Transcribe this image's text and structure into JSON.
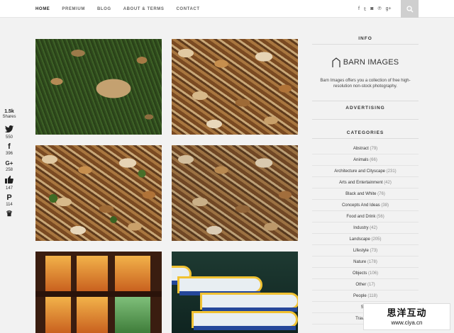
{
  "nav": {
    "items": [
      "HOME",
      "PREMIUM",
      "BLOG",
      "ABOUT & TERMS",
      "CONTACT"
    ],
    "social": [
      "f",
      "𝕥",
      "◙",
      "℗",
      "g+"
    ]
  },
  "share": {
    "total": "1.5k",
    "label": "Shares",
    "items": [
      {
        "icon": "twitter-icon",
        "glyph": "🐦",
        "count": "550"
      },
      {
        "icon": "facebook-icon",
        "glyph": "f",
        "count": "396"
      },
      {
        "icon": "googleplus-icon",
        "glyph": "G+",
        "count": "258"
      },
      {
        "icon": "like-icon",
        "glyph": "👍",
        "count": "147"
      },
      {
        "icon": "pinterest-icon",
        "glyph": "P",
        "count": "114"
      },
      {
        "icon": "crown-icon",
        "glyph": "♛",
        "count": ""
      }
    ]
  },
  "sidebar": {
    "info_title": "INFO",
    "logo_text": "BARN IMAGES",
    "about": "Barn Images offers you a collection of free high-resolution non-stock photography.",
    "advertising_title": "ADVERTISING",
    "categories_title": "CATEGORIES",
    "categories": [
      {
        "name": "Abstract",
        "count": "(79)"
      },
      {
        "name": "Animals",
        "count": "(66)"
      },
      {
        "name": "Architecture and Cityscape",
        "count": "(231)"
      },
      {
        "name": "Arts and Entertainment",
        "count": "(42)"
      },
      {
        "name": "Black and White",
        "count": "(76)"
      },
      {
        "name": "Concepts And Ideas",
        "count": "(38)"
      },
      {
        "name": "Food and Drink",
        "count": "(56)"
      },
      {
        "name": "Industry",
        "count": "(42)"
      },
      {
        "name": "Landscape",
        "count": "(205)"
      },
      {
        "name": "Lifestyle",
        "count": "(73)"
      },
      {
        "name": "Nature",
        "count": "(178)"
      },
      {
        "name": "Objects",
        "count": "(106)"
      },
      {
        "name": "Other",
        "count": "(17)"
      },
      {
        "name": "People",
        "count": "(118)"
      },
      {
        "name": "Spor",
        "count": ""
      },
      {
        "name": "Travel Loc",
        "count": ""
      }
    ]
  },
  "watermark": {
    "title": "思洋互动",
    "url": "www.ciya.cn"
  }
}
